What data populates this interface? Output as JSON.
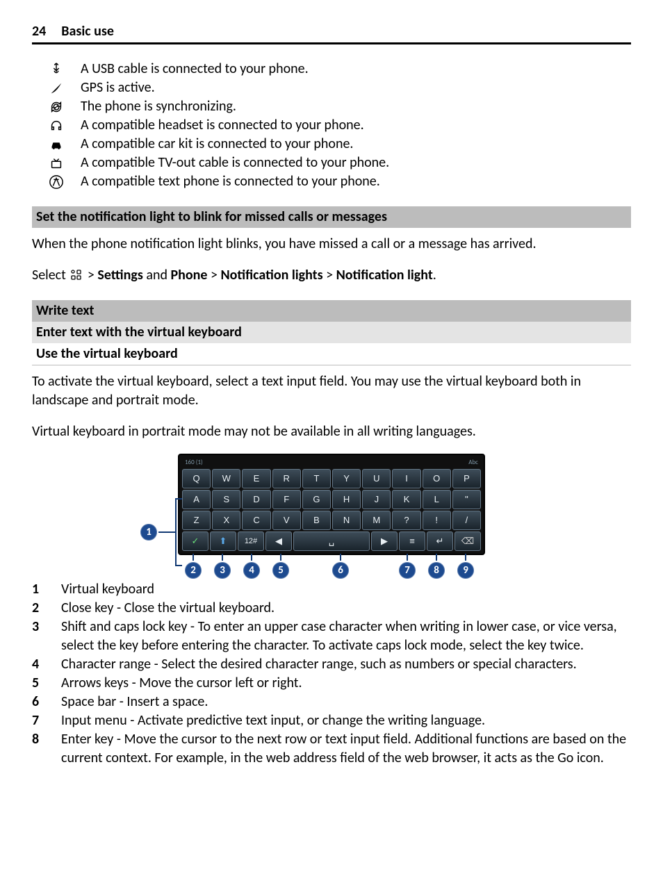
{
  "page_number": "24",
  "page_title": "Basic use",
  "icon_rows": [
    {
      "name": "usb",
      "text": "A USB cable is connected to your phone."
    },
    {
      "name": "gps",
      "text": "GPS is active."
    },
    {
      "name": "sync",
      "text": "The phone is synchronizing."
    },
    {
      "name": "headset",
      "text": "A compatible headset is connected to your phone."
    },
    {
      "name": "carkit",
      "text": "A compatible car kit is connected to your phone."
    },
    {
      "name": "tvout",
      "text": "A compatible TV-out cable is connected to your phone."
    },
    {
      "name": "textphone",
      "text": "A compatible text phone is connected to your phone."
    }
  ],
  "section_notif_heading": "Set the notification light to blink for missed calls or messages",
  "notif_p1": "When the phone notification light blinks, you have missed a call or a message has arrived.",
  "select_line": {
    "prefix": "Select ",
    "parts": [
      "Settings",
      "Phone",
      "Notification lights",
      "Notification light"
    ],
    "and": " and ",
    "gt": " > ",
    "suffix": "."
  },
  "section_write_heading": "Write text",
  "section_write_sub1": "Enter text with the virtual keyboard",
  "section_write_sub2": "Use the virtual keyboard",
  "write_p1": "To activate the virtual keyboard, select a text input field. You may use the virtual keyboard both in landscape and portrait mode.",
  "write_p2": "Virtual keyboard in portrait mode may not be available in all writing languages.",
  "kb_top_left": "160 (1)",
  "kb_top_right": "Abc",
  "kb_rows": [
    [
      "Q",
      "W",
      "E",
      "R",
      "T",
      "Y",
      "U",
      "I",
      "O",
      "P"
    ],
    [
      "A",
      "S",
      "D",
      "F",
      "G",
      "H",
      "J",
      "K",
      "L",
      "\""
    ],
    [
      "Z",
      "X",
      "C",
      "V",
      "B",
      "N",
      "M",
      "?",
      "!",
      "/"
    ]
  ],
  "kb_bottom": {
    "close": "✓",
    "shift": "⬆",
    "range": "12#",
    "left": "◀",
    "space": "␣",
    "right": "▶",
    "menu": "≡",
    "enter": "↵",
    "backspace": "⌫"
  },
  "left_callout": "1",
  "bottom_callouts": [
    "2",
    "3",
    "4",
    "5",
    "6",
    "7",
    "8",
    "9"
  ],
  "legend": [
    {
      "n": "1",
      "t": "Virtual keyboard"
    },
    {
      "n": "2",
      "t": "Close key - Close the virtual keyboard."
    },
    {
      "n": "3",
      "t": "Shift and caps lock key - To enter an upper case character when writing in lower case, or vice versa, select the key before entering the character. To activate caps lock mode, select the key twice."
    },
    {
      "n": "4",
      "t": "Character range - Select the desired character range, such as numbers or special characters."
    },
    {
      "n": "5",
      "t": "Arrows keys - Move the cursor left or right."
    },
    {
      "n": "6",
      "t": "Space bar - Insert a space."
    },
    {
      "n": "7",
      "t": "Input menu - Activate predictive text input, or change the writing language."
    },
    {
      "n": "8",
      "t": "Enter key - Move the cursor to the next row or text input field. Additional functions are based on the current context. For example, in the web address field of the web browser, it acts as the Go icon."
    }
  ]
}
